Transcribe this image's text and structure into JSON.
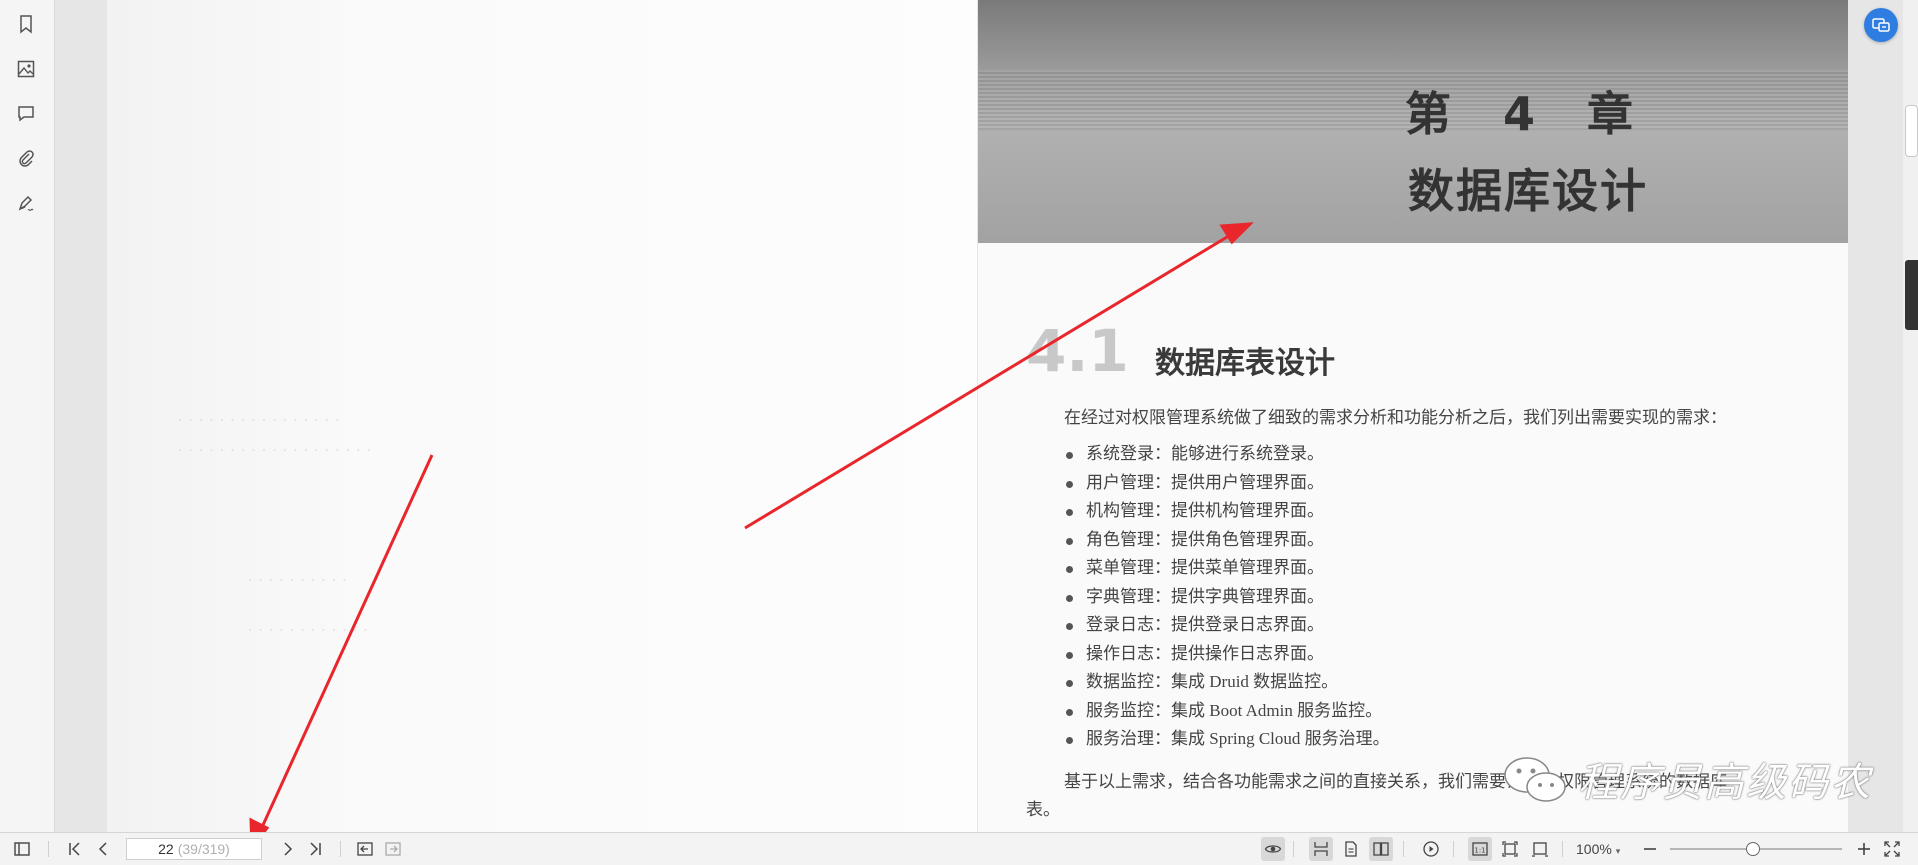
{
  "page": {
    "chapter_number": "第 4 章",
    "chapter_title": "数据库设计",
    "section_number": "4.1",
    "section_title": "数据库表设计",
    "intro": "在经过对权限管理系统做了细致的需求分析和功能分析之后，我们列出需要实现的需求：",
    "requirements": [
      "系统登录：能够进行系统登录。",
      "用户管理：提供用户管理界面。",
      "机构管理：提供机构管理界面。",
      "角色管理：提供角色管理界面。",
      "菜单管理：提供菜单管理界面。",
      "字典管理：提供字典管理界面。",
      "登录日志：提供登录日志界面。",
      "操作日志：提供操作日志界面。",
      "数据监控：集成 Druid 数据监控。",
      "服务监控：集成 Boot Admin 服务监控。",
      "服务治理：集成 Spring Cloud 服务治理。"
    ],
    "closing_line_1": "基于以上需求，结合各功能需求之间的直接关系，我们需要设计出权限管理系统的数据库",
    "closing_line_2": "表。",
    "watermark": "程序员高级码农"
  },
  "toolbar": {
    "page_current": "22",
    "page_total": "(39/319)",
    "zoom": "100%"
  },
  "colors": {
    "annotation_arrow": "#e8262b",
    "accent": "#2f7de1"
  },
  "icons": {
    "left_rail": [
      "bookmark-icon",
      "image-icon",
      "comment-icon",
      "attachment-icon",
      "signature-icon"
    ],
    "toolbar": [
      "sidebar-toggle-icon",
      "first-page-icon",
      "prev-page-icon",
      "next-page-icon",
      "last-page-icon",
      "back-icon",
      "forward-icon",
      "eye-icon",
      "continuous-page-icon",
      "single-page-icon",
      "two-page-icon",
      "play-icon",
      "actual-size-icon",
      "fit-page-icon",
      "fit-width-icon",
      "zoom-out-icon",
      "zoom-in-icon",
      "fullscreen-icon"
    ]
  }
}
